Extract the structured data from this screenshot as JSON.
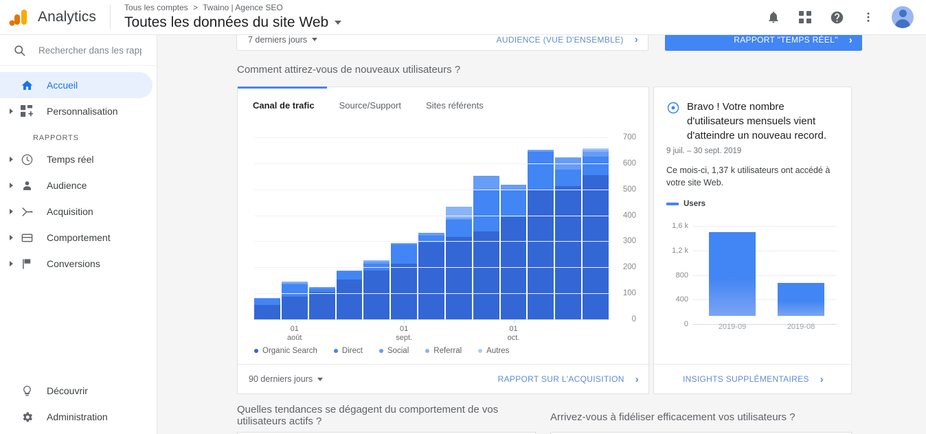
{
  "topbar": {
    "brand": "Analytics",
    "breadcrumb": {
      "account": "Tous les comptes",
      "separator": ">",
      "property": "Twaino | Agence SEO"
    },
    "property_title": "Toutes les données du site Web",
    "icons": [
      "notifications-bell-icon",
      "apps-grid-icon",
      "help-icon",
      "more-vert-icon",
      "avatar"
    ]
  },
  "sidebar": {
    "search": {
      "placeholder": "Rechercher dans les rapport"
    },
    "items": [
      {
        "label": "Accueil",
        "icon": "home-icon",
        "active": true,
        "expandable": false
      },
      {
        "label": "Personnalisation",
        "icon": "customization-icon",
        "active": false,
        "expandable": true
      }
    ],
    "section_label": "RAPPORTS",
    "reports": [
      {
        "label": "Temps réel",
        "icon": "clock-icon"
      },
      {
        "label": "Audience",
        "icon": "person-icon"
      },
      {
        "label": "Acquisition",
        "icon": "acquisition-icon"
      },
      {
        "label": "Comportement",
        "icon": "behavior-icon"
      },
      {
        "label": "Conversions",
        "icon": "flag-icon"
      }
    ],
    "bottom": [
      {
        "label": "Découvrir",
        "icon": "lightbulb-icon"
      },
      {
        "label": "Administration",
        "icon": "gear-icon"
      }
    ]
  },
  "topcards": {
    "left_select": "7 derniers jours",
    "left_link": "AUDIENCE (VUE D'ENSEMBLE)",
    "right_link": "RAPPORT \"TEMPS RÉEL\""
  },
  "main": {
    "heading_new_users": "Comment attirez-vous de nouveaux utilisateurs ?",
    "heading_trends": "Quelles tendances se dégagent du comportement de vos utilisateurs actifs ?",
    "heading_loyalty": "Arrivez-vous à fidéliser efficacement vos utilisateurs ?",
    "tabs": [
      {
        "label": "Canal de trafic",
        "active": true
      },
      {
        "label": "Source/Support",
        "active": false
      },
      {
        "label": "Sites référents",
        "active": false
      }
    ],
    "footer": {
      "range_select": "90 derniers jours",
      "link": "RAPPORT SUR L'ACQUISITION"
    }
  },
  "insight": {
    "icon": "insight-icon",
    "title": "Bravo ! Votre nombre d'utilisateurs mensuels vient d'atteindre un nouveau record.",
    "date_range": "9 juil. – 30 sept. 2019",
    "body": "Ce mois-ci, 1,37 k utilisateurs ont accédé à votre site Web.",
    "footer_link": "INSIGHTS SUPPLÉMENTAIRES"
  },
  "colors": {
    "accent": "#4285f4",
    "organic_search": "#3367d6",
    "direct": "#4285f4",
    "social": "#669df6",
    "referral": "#8ab4f8",
    "autres": "#aecbfa",
    "link": "#5f8bd6",
    "active_nav": "#1a73e8",
    "active_nav_bg": "#e8f0fe"
  },
  "chart_data": [
    {
      "id": "acquisition-stacked-bar",
      "type": "bar",
      "stacked": true,
      "title": "Comment attirez-vous de nouveaux utilisateurs ?",
      "xlabel": "",
      "ylabel": "",
      "ylim": [
        0,
        700
      ],
      "yticks": [
        0,
        100,
        200,
        300,
        400,
        500,
        600,
        700
      ],
      "ytick_labels": [
        "0",
        "100",
        "200",
        "300",
        "400",
        "500",
        "600",
        "700"
      ],
      "grid": true,
      "legend_position": "bottom",
      "categories": [
        "w1",
        "w2",
        "w3",
        "w4",
        "w5",
        "w6",
        "w7",
        "w8",
        "w9",
        "w10",
        "w11",
        "w12",
        "w13"
      ],
      "xtick_labels": [
        {
          "at_index": 1,
          "line1": "01",
          "line2": "août"
        },
        {
          "at_index": 5,
          "line1": "01",
          "line2": "sept."
        },
        {
          "at_index": 9,
          "line1": "01",
          "line2": "oct."
        }
      ],
      "series": [
        {
          "name": "Organic Search",
          "color": "#3367d6",
          "values": [
            55,
            88,
            105,
            153,
            188,
            215,
            297,
            316,
            338,
            393,
            499,
            512,
            555
          ]
        },
        {
          "name": "Direct",
          "color": "#4285f4",
          "values": [
            25,
            48,
            15,
            32,
            25,
            73,
            25,
            68,
            158,
            107,
            146,
            65,
            72
          ]
        },
        {
          "name": "Social",
          "color": "#669df6",
          "values": [
            3,
            5,
            3,
            3,
            10,
            5,
            10,
            4,
            55,
            18,
            6,
            45,
            18
          ]
        },
        {
          "name": "Referral",
          "color": "#8ab4f8",
          "values": [
            0,
            4,
            0,
            0,
            4,
            0,
            2,
            44,
            0,
            0,
            2,
            2,
            8
          ]
        },
        {
          "name": "Autres",
          "color": "#aecbfa",
          "values": [
            0,
            0,
            0,
            0,
            0,
            0,
            0,
            0,
            0,
            0,
            0,
            0,
            5
          ]
        }
      ]
    },
    {
      "id": "insight-monthly-users",
      "type": "bar",
      "stacked": false,
      "title": "Users",
      "xlabel": "",
      "ylabel": "",
      "ylim": [
        0,
        1600
      ],
      "yticks": [
        0,
        400,
        800,
        1200,
        1600
      ],
      "ytick_labels": [
        "0",
        "400",
        "800",
        "1,2 k",
        "1,6 k"
      ],
      "grid": true,
      "legend_position": "top",
      "categories": [
        "2019-09",
        "2019-08"
      ],
      "series": [
        {
          "name": "Users",
          "color": "#4285f4",
          "values": [
            1370,
            540
          ]
        }
      ]
    }
  ]
}
